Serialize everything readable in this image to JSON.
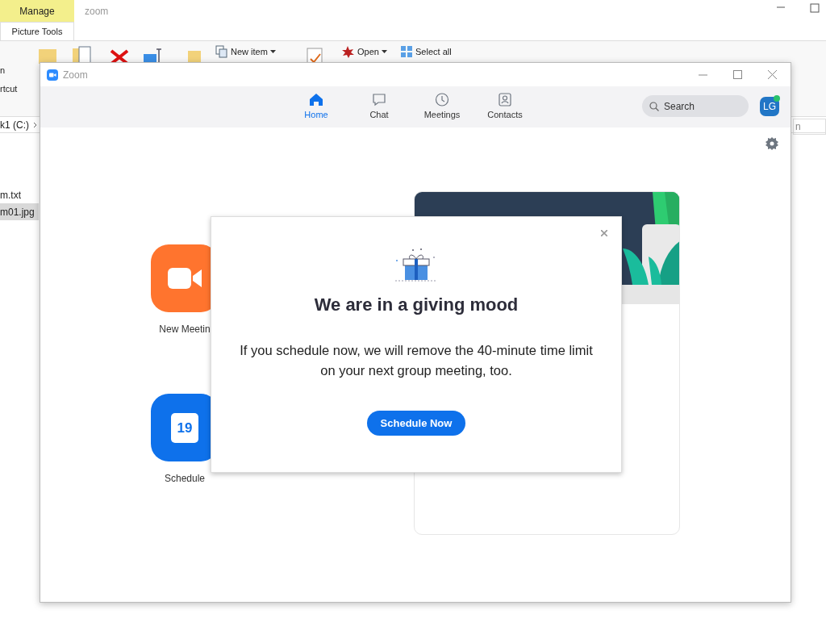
{
  "explorer": {
    "contextual_tab": {
      "label": "Manage",
      "group": "Picture Tools"
    },
    "title": "zoom",
    "ribbon_left": [
      "n",
      "rtcut"
    ],
    "ribbon_buttons": [
      {
        "label": "New item",
        "kind": "newitem",
        "dropdown": true
      },
      {
        "label": "Open",
        "kind": "open",
        "dropdown": true
      },
      {
        "label": "Select all",
        "kind": "selectall",
        "dropdown": false
      }
    ],
    "address": "k1 (C:)",
    "search_fragment": "n",
    "files": [
      {
        "name": "m.txt",
        "selected": false
      },
      {
        "name": "m01.jpg",
        "selected": true
      }
    ]
  },
  "zoom": {
    "window_title": "Zoom",
    "tabs": [
      {
        "label": "Home",
        "kind": "home",
        "selected": true
      },
      {
        "label": "Chat",
        "kind": "chat",
        "selected": false
      },
      {
        "label": "Meetings",
        "kind": "clock",
        "selected": false
      },
      {
        "label": "Contacts",
        "kind": "contact",
        "selected": false
      }
    ],
    "search": {
      "placeholder": "Search"
    },
    "avatar": {
      "initials": "LG",
      "online": true
    },
    "tiles": [
      {
        "label": "New Meetin",
        "kind": "video",
        "color": "#ff742e"
      },
      {
        "label": "Schedule",
        "kind": "calendar",
        "color": "#0e71eb",
        "day": "19"
      }
    ],
    "dialog": {
      "title": "We are in a giving mood",
      "body": "If you schedule now, we will remove the 40-minute time limit on your next group meeting, too.",
      "button": "Schedule Now"
    }
  }
}
